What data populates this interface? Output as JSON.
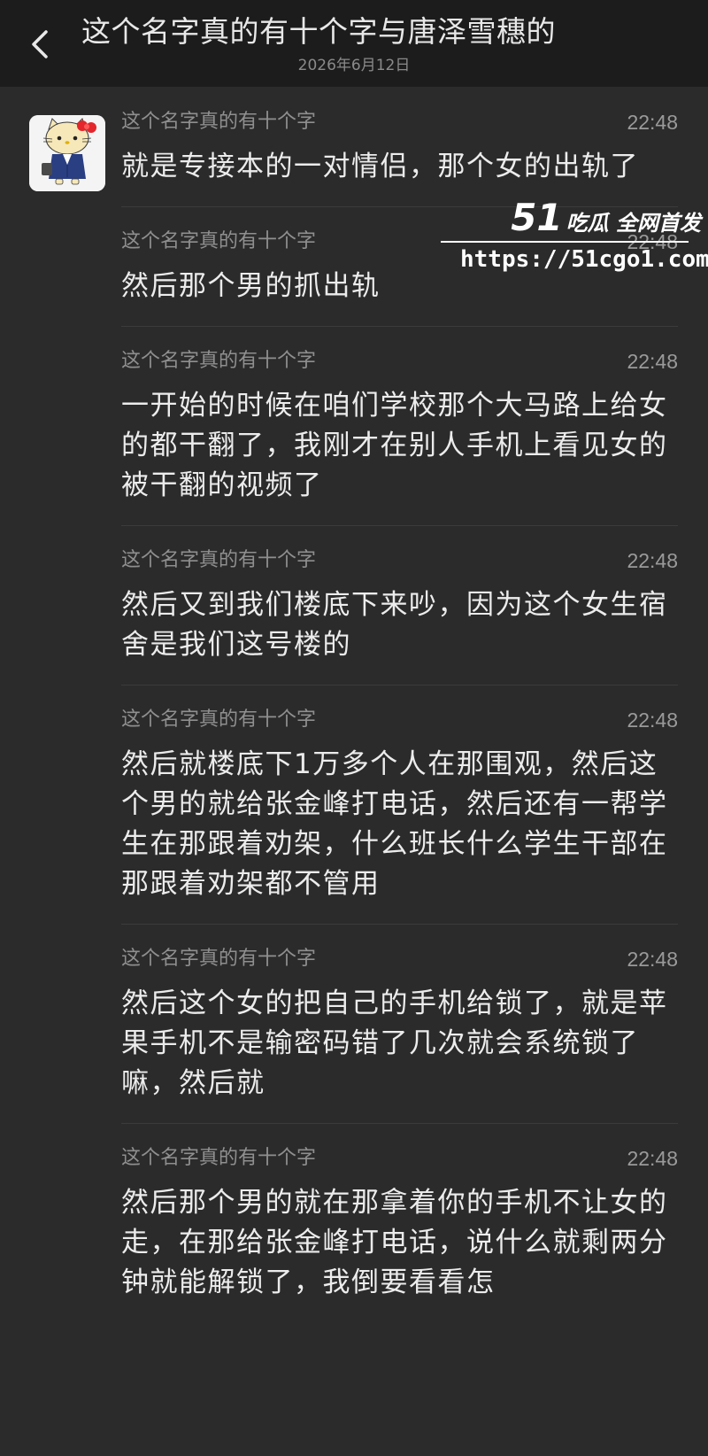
{
  "header": {
    "title": "这个名字真的有十个字与唐泽雪穗的",
    "subtitle": "2026年6月12日",
    "back_icon": "chevron-left-icon"
  },
  "colors": {
    "header_bg": "#1c1c1c",
    "page_bg": "#2b2b2b",
    "message_text": "#ececec",
    "meta_text": "#8f8f8f"
  },
  "watermark": {
    "brand_number": "51",
    "brand_text": "吃瓜 全网首发",
    "url": "https://51cgo1.com"
  },
  "messages": [
    {
      "sender": "这个名字真的有十个字",
      "time": "22:48",
      "text": "就是专接本的一对情侣，那个女的出轨了"
    },
    {
      "sender": "这个名字真的有十个字",
      "time": "22:48",
      "text": "然后那个男的抓出轨"
    },
    {
      "sender": "这个名字真的有十个字",
      "time": "22:48",
      "text": "一开始的时候在咱们学校那个大马路上给女的都干翻了，我刚才在别人手机上看见女的被干翻的视频了"
    },
    {
      "sender": "这个名字真的有十个字",
      "time": "22:48",
      "text": "然后又到我们楼底下来吵，因为这个女生宿舍是我们这号楼的"
    },
    {
      "sender": "这个名字真的有十个字",
      "time": "22:48",
      "text": "然后就楼底下1万多个人在那围观，然后这个男的就给张金峰打电话，然后还有一帮学生在那跟着劝架，什么班长什么学生干部在那跟着劝架都不管用"
    },
    {
      "sender": "这个名字真的有十个字",
      "time": "22:48",
      "text": "然后这个女的把自己的手机给锁了，就是苹果手机不是输密码错了几次就会系统锁了嘛，然后就"
    },
    {
      "sender": "这个名字真的有十个字",
      "time": "22:48",
      "text": "然后那个男的就在那拿着你的手机不让女的走，在那给张金峰打电话，说什么就剩两分钟就能解锁了，我倒要看看怎"
    }
  ]
}
